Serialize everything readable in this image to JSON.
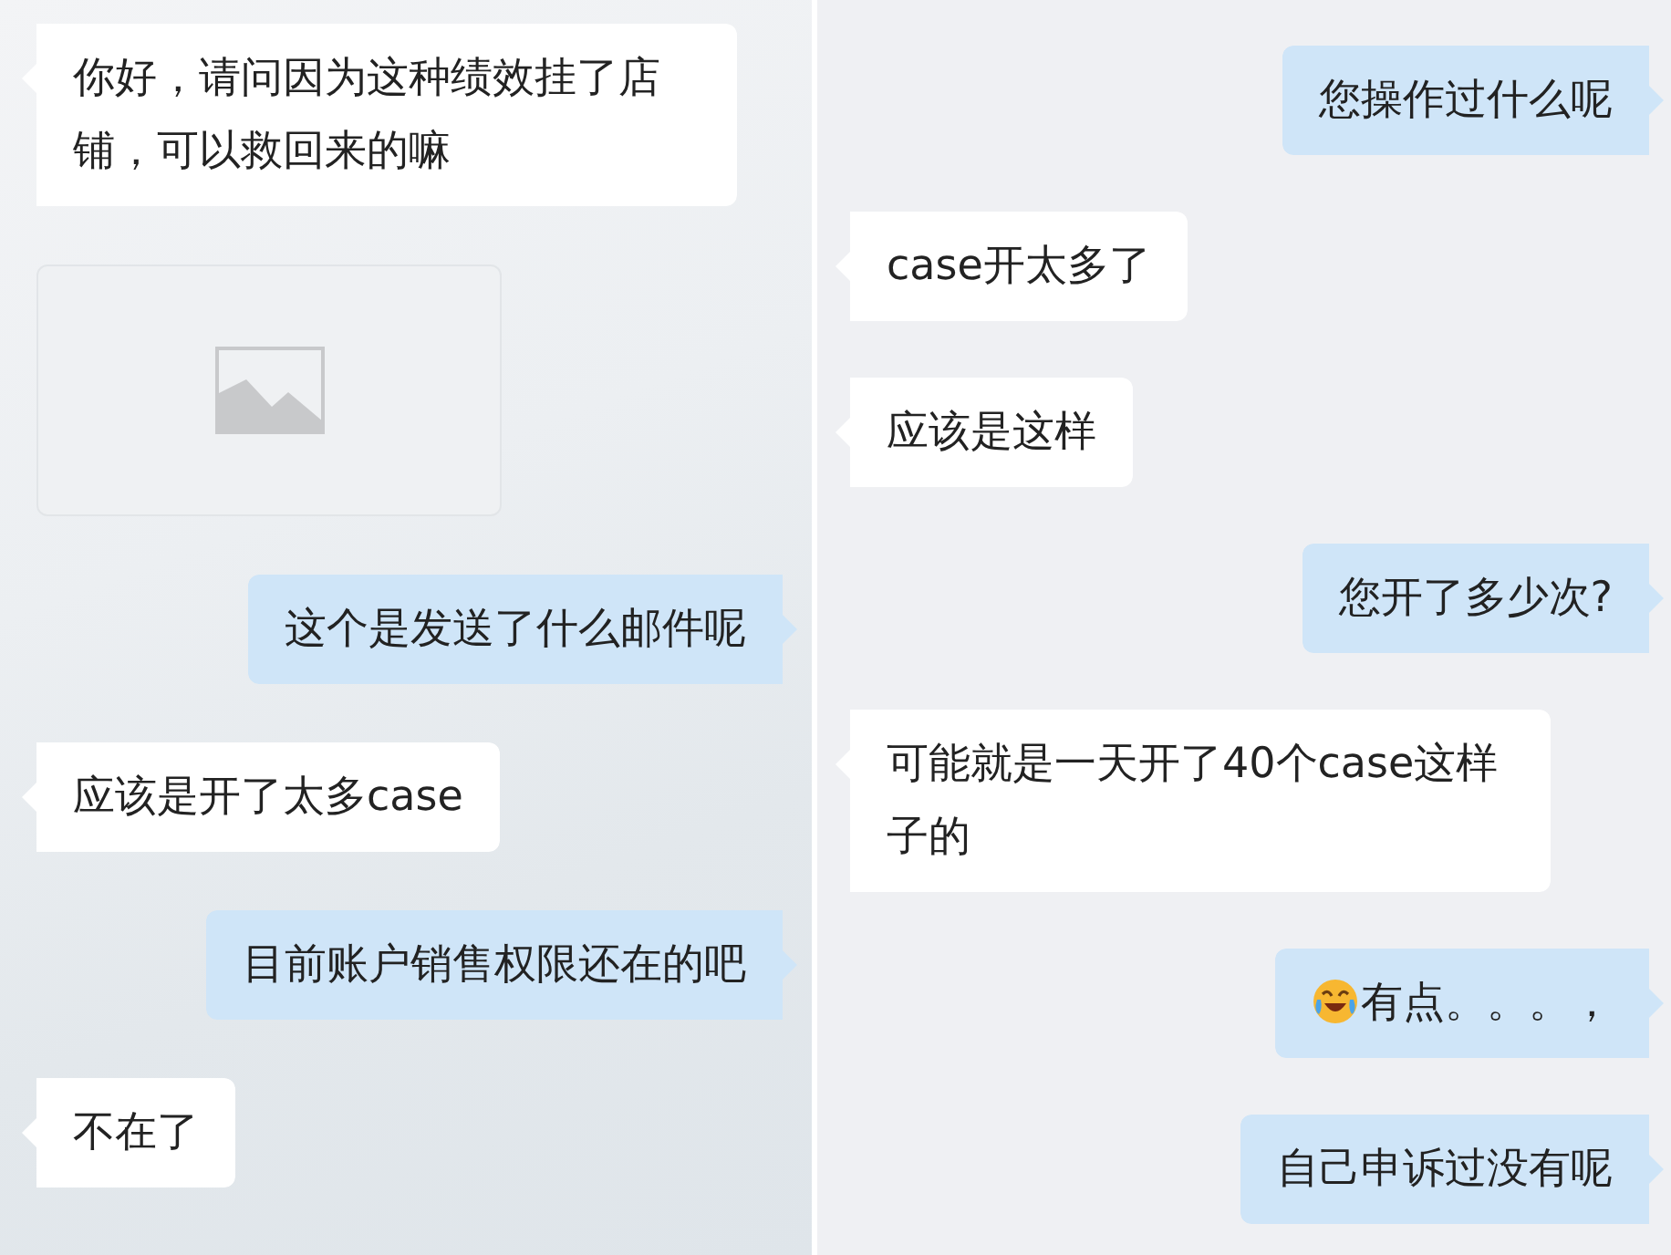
{
  "panels": [
    {
      "messages": [
        {
          "kind": "text",
          "sent": false,
          "text": "你好，请问因为这种绩效挂了店铺，可以救回来的嘛"
        },
        {
          "kind": "image",
          "sent": false
        },
        {
          "kind": "text",
          "sent": true,
          "text": "这个是发送了什么邮件呢"
        },
        {
          "kind": "text",
          "sent": false,
          "text": "应该是开了太多case"
        },
        {
          "kind": "text",
          "sent": true,
          "text": "目前账户销售权限还在的吧"
        },
        {
          "kind": "text",
          "sent": false,
          "text": "不在了"
        }
      ]
    },
    {
      "messages": [
        {
          "kind": "text",
          "sent": true,
          "text": "您操作过什么呢"
        },
        {
          "kind": "text",
          "sent": false,
          "text": "case开太多了"
        },
        {
          "kind": "text",
          "sent": false,
          "text": "应该是这样"
        },
        {
          "kind": "text",
          "sent": true,
          "text": "您开了多少次?"
        },
        {
          "kind": "text",
          "sent": false,
          "text": "可能就是一天开了40个case这样子的"
        },
        {
          "kind": "emoji_text",
          "sent": true,
          "text": "有点。。。，"
        },
        {
          "kind": "text",
          "sent": true,
          "text": "自己申诉过没有呢"
        }
      ]
    }
  ]
}
